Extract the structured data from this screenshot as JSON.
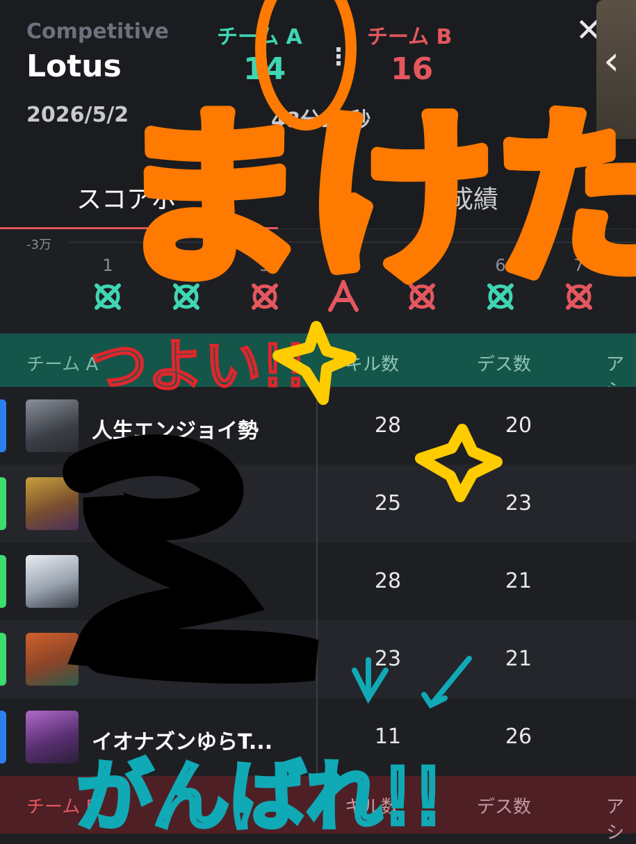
{
  "header": {
    "mode": "Competitive",
    "map": "Lotus",
    "team_a_label": "チーム A",
    "team_b_label": "チーム B",
    "score_a": "14",
    "score_b": "16",
    "date": "2026/5/2",
    "duration": "48分24秒"
  },
  "tabs": {
    "scoreboard": "スコアボード",
    "stats": "成績"
  },
  "round_chart": {
    "y_label": "-3万",
    "rounds": [
      {
        "n": "1",
        "winner": "A",
        "icon": "defuse-icon"
      },
      {
        "n": "2",
        "winner": "A",
        "icon": "defuse-icon"
      },
      {
        "n": "3",
        "winner": "B",
        "icon": "defuse-icon"
      },
      {
        "n": "4",
        "winner": "B",
        "icon": "elimination-icon"
      },
      {
        "n": "5",
        "winner": "B",
        "icon": "defuse-icon"
      },
      {
        "n": "6",
        "winner": "A",
        "icon": "defuse-icon"
      },
      {
        "n": "7",
        "winner": "B",
        "icon": "defuse-icon"
      }
    ]
  },
  "table_header_a": {
    "team": "チーム A",
    "kills": "キル数",
    "deaths": "デス数",
    "assists": "アシ"
  },
  "players_a": [
    {
      "name": "人生エンジョイ勢",
      "kills": "28",
      "deaths": "20",
      "accent": "#2d7ff0"
    },
    {
      "name": "",
      "kills": "25",
      "deaths": "23",
      "accent": "#3ddc6e"
    },
    {
      "name": "",
      "kills": "28",
      "deaths": "21",
      "accent": "#3ddc6e"
    },
    {
      "name": "",
      "kills": "23",
      "deaths": "21",
      "accent": "#3ddc6e"
    },
    {
      "name": "イオナズンゆらT...",
      "kills": "11",
      "deaths": "26",
      "accent": "#2d7ff0"
    }
  ],
  "table_header_b": {
    "team": "チーム B",
    "kills": "キル数",
    "deaths": "デス数",
    "assists": "アシ"
  },
  "annotations": {
    "lost": "まけた",
    "strong": "つよい!!",
    "cheer": "がんばれ!!"
  },
  "colors": {
    "team_a": "#3fd6b3",
    "team_b": "#e5575e",
    "marker_orange": "#ff7a00"
  }
}
